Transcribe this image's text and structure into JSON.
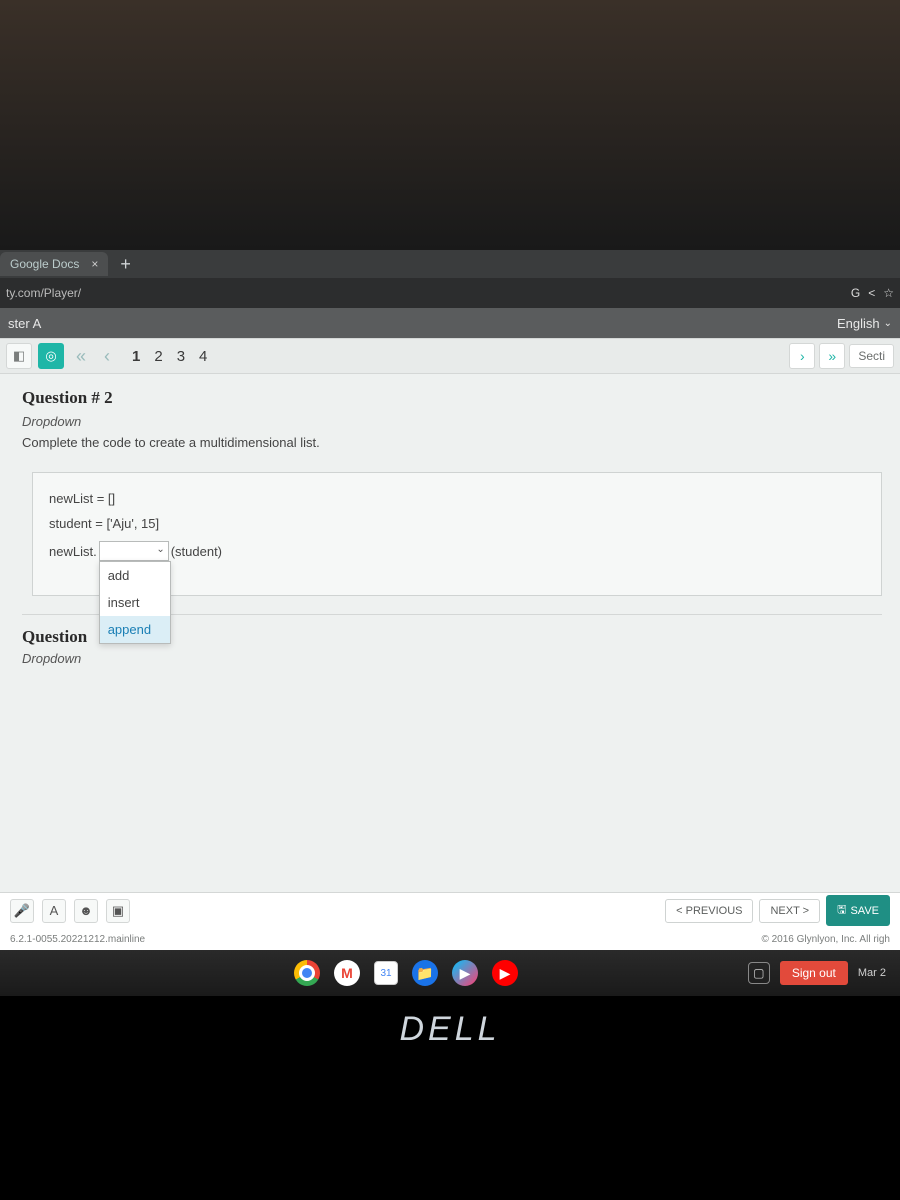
{
  "browser": {
    "tab_title": "Google Docs",
    "close_glyph": "×",
    "newtab_glyph": "+",
    "url_fragment": "ty.com/Player/",
    "toolbar_icons": {
      "google": "G",
      "less": "<",
      "star": "☆"
    }
  },
  "appbar": {
    "title_fragment": "ster A",
    "language": "English"
  },
  "qnav": {
    "numbers": [
      "1",
      "2",
      "3",
      "4"
    ],
    "active": "1",
    "section_label": "Secti"
  },
  "question": {
    "title": "Question # 2",
    "type": "Dropdown",
    "prompt": "Complete the code to create a multidimensional list.",
    "code": {
      "line1": "newList = []",
      "line2": "student = ['Aju', 15]",
      "line3_prefix": "newList.",
      "line3_suffix": "(student)"
    },
    "dropdown_options": [
      "add",
      "insert",
      "append"
    ],
    "dropdown_selected": "append",
    "next_title_fragment": "Question",
    "next_type": "Dropdown"
  },
  "actions": {
    "previous": "< PREVIOUS",
    "next": "NEXT >",
    "save": "SAVE",
    "save_icon": "🖫"
  },
  "footer": {
    "version": "6.2.1-0055.20221212.mainline",
    "copyright": "© 2016 Glynlyon, Inc. All righ"
  },
  "shelf": {
    "calendar_day": "31",
    "signout": "Sign out",
    "date": "Mar 2"
  },
  "logo": "DELL"
}
